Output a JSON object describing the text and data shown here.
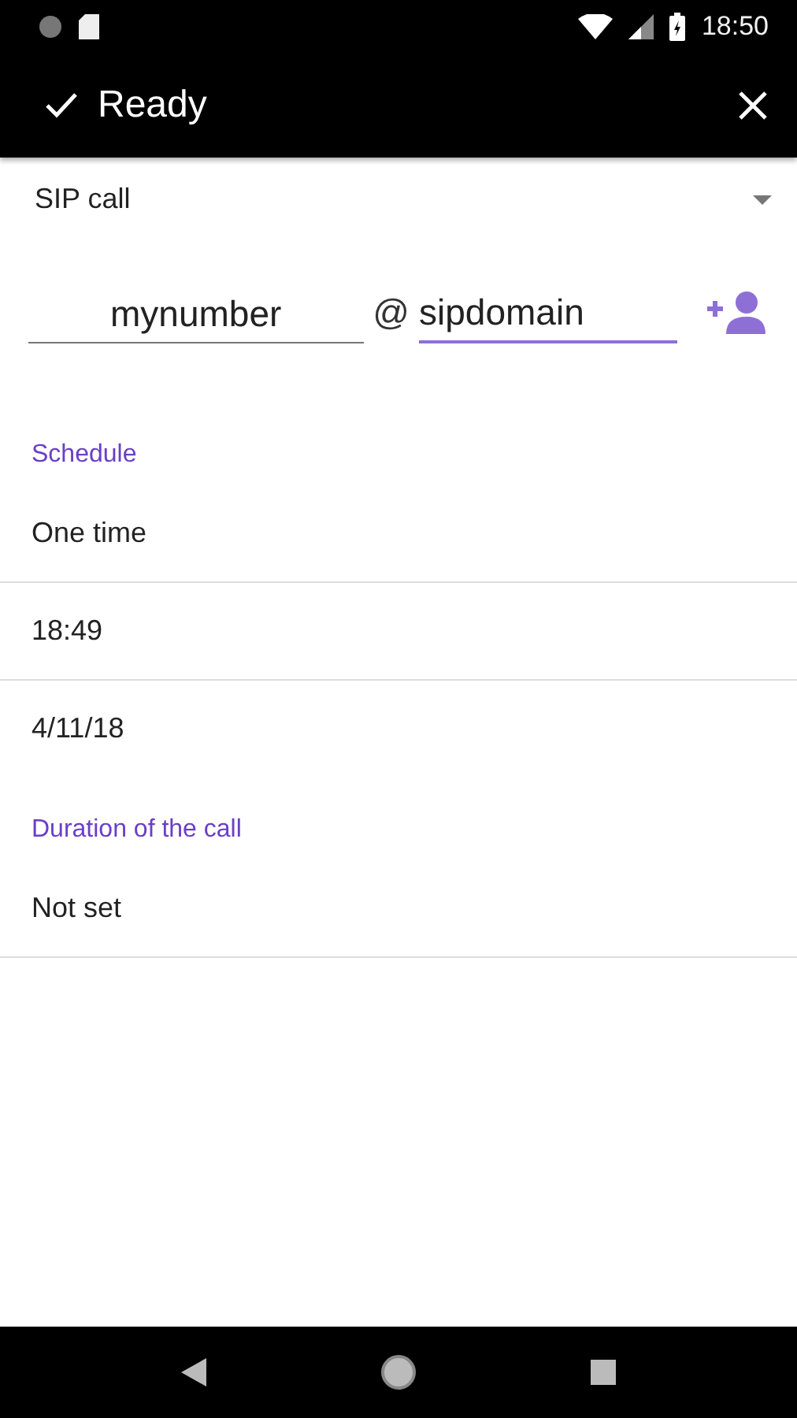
{
  "status_bar": {
    "time": "18:50"
  },
  "toolbar": {
    "title": "Ready"
  },
  "call_type": {
    "value": "SIP call"
  },
  "address": {
    "fields": [
      {
        "value": "mynumber",
        "focused": false
      },
      {
        "value": "sipdomain",
        "focused": true
      }
    ],
    "separator": "@"
  },
  "sections": [
    {
      "header": "Schedule",
      "items": [
        {
          "text": "One time",
          "divider": true
        },
        {
          "text": "18:49",
          "divider": true
        },
        {
          "text": "4/11/18",
          "divider": false
        }
      ]
    },
    {
      "header": "Duration of the call",
      "items": [
        {
          "text": "Not set",
          "divider": true
        }
      ]
    }
  ]
}
